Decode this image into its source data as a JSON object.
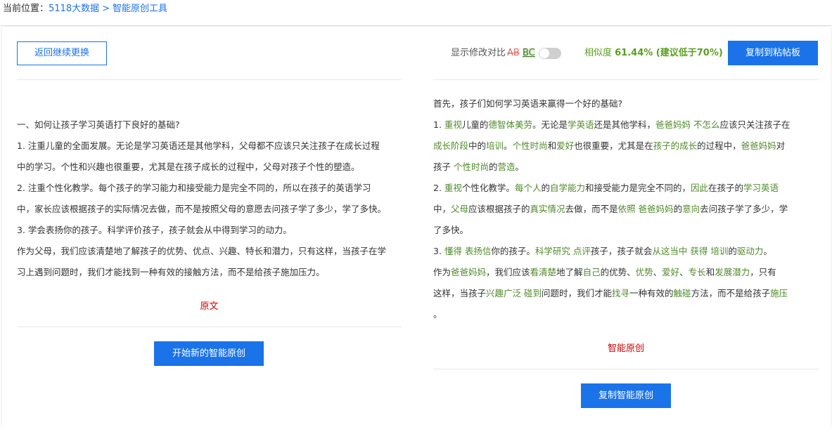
{
  "breadcrumb": {
    "prefix": "当前位置：",
    "home": "5118大数据",
    "sep": ">",
    "current": "智能原创工具"
  },
  "toolbar": {
    "back_label": "返回继续更换",
    "diff_label": "显示修改对比",
    "diff_ab": "AB",
    "diff_bc": "BC",
    "diff_toggle_on": false,
    "similarity_prefix": "相似度 ",
    "similarity_value": "61.44% (建议低于70%)",
    "copy_clipboard_label": "复制到粘帖板"
  },
  "original": {
    "lines": [
      " 一、如何让孩子学习英语打下良好的基础?",
      "1. 注重儿童的全面发展。无论是学习英语还是其他学科，父母都不应该只关注孩子在成长过程",
      "中的学习。个性和兴趣也很重要，尤其是在孩子成长的过程中，父母对孩子个性的塑造。",
      "2. 注重个性化教学。每个孩子的学习能力和接受能力是完全不同的，所以在孩子的英语学习",
      "中，家长应该根据孩子的实际情况去做，而不是按照父母的意愿去问孩子学了多少，学了多快。",
      "3. 学会表扬你的孩子。科学评价孩子，孩子就会从中得到学习的动力。",
      "作为父母，我们应该清楚地了解孩子的优势、优点、兴趣、特长和潜力，只有这样，当孩子在学",
      "习上遇到问题时，我们才能找到一种有效的接触方法，而不是给孩子施加压力。"
    ],
    "label": "原文",
    "start_button": "开始新的智能原创"
  },
  "rewritten": {
    "lines": [
      [
        {
          "t": "首先，孩子们如何学习英语来赢得一个好的基础?",
          "h": false
        }
      ],
      [
        {
          "t": "1. ",
          "h": false
        },
        {
          "t": "重视",
          "h": true
        },
        {
          "t": "儿童的",
          "h": false
        },
        {
          "t": "德智体美劳",
          "h": true
        },
        {
          "t": "。无论是",
          "h": false
        },
        {
          "t": "学英语",
          "h": true
        },
        {
          "t": "还是其他学科，",
          "h": false
        },
        {
          "t": "爸爸妈妈 不怎么",
          "h": true
        },
        {
          "t": "应该只关注孩子在",
          "h": false
        }
      ],
      [
        {
          "t": "成长阶段",
          "h": true
        },
        {
          "t": "中的",
          "h": false
        },
        {
          "t": "培训",
          "h": true
        },
        {
          "t": "。",
          "h": false
        },
        {
          "t": "个性时尚",
          "h": true
        },
        {
          "t": "和",
          "h": false
        },
        {
          "t": "爱好",
          "h": true
        },
        {
          "t": "也很重要，尤其是在",
          "h": false
        },
        {
          "t": "孩子的成长",
          "h": true
        },
        {
          "t": "的过程中，",
          "h": false
        },
        {
          "t": "爸爸妈妈",
          "h": true
        },
        {
          "t": "对",
          "h": false
        }
      ],
      [
        {
          "t": "孩子 ",
          "h": false
        },
        {
          "t": "个性时尚",
          "h": true
        },
        {
          "t": "的",
          "h": false
        },
        {
          "t": "营造",
          "h": true
        },
        {
          "t": "。",
          "h": false
        }
      ],
      [
        {
          "t": "2. ",
          "h": false
        },
        {
          "t": "重视",
          "h": true
        },
        {
          "t": "个性化教学。",
          "h": false
        },
        {
          "t": "每个人",
          "h": true
        },
        {
          "t": "的",
          "h": false
        },
        {
          "t": "自学能力",
          "h": true
        },
        {
          "t": "和接受能力是完全不同的，",
          "h": false
        },
        {
          "t": "因此",
          "h": true
        },
        {
          "t": "在孩子的",
          "h": false
        },
        {
          "t": "学习英语",
          "h": true
        }
      ],
      [
        {
          "t": "中，",
          "h": false
        },
        {
          "t": "父母",
          "h": true
        },
        {
          "t": "应该根据孩子的",
          "h": false
        },
        {
          "t": "真实情况",
          "h": true
        },
        {
          "t": "去做，而不是",
          "h": false
        },
        {
          "t": "依照 爸爸妈妈",
          "h": true
        },
        {
          "t": "的",
          "h": false
        },
        {
          "t": "意向",
          "h": true
        },
        {
          "t": "去问孩子学了多少，学",
          "h": false
        }
      ],
      [
        {
          "t": "了多快。",
          "h": false
        }
      ],
      [
        {
          "t": "3. ",
          "h": false
        },
        {
          "t": "懂得 表扬信",
          "h": true
        },
        {
          "t": "你的孩子。",
          "h": false
        },
        {
          "t": "科学研究 点评",
          "h": true
        },
        {
          "t": "孩子，孩子就会",
          "h": false
        },
        {
          "t": "从这当中 获得 培训",
          "h": true
        },
        {
          "t": "的",
          "h": false
        },
        {
          "t": "驱动力",
          "h": true
        },
        {
          "t": "。",
          "h": false
        }
      ],
      [
        {
          "t": "作为",
          "h": false
        },
        {
          "t": "爸爸妈妈",
          "h": true
        },
        {
          "t": "，我们应该",
          "h": false
        },
        {
          "t": "看清楚",
          "h": true
        },
        {
          "t": "地了解",
          "h": false
        },
        {
          "t": "自己",
          "h": true
        },
        {
          "t": "的优势、",
          "h": false
        },
        {
          "t": "优势",
          "h": true
        },
        {
          "t": "、",
          "h": false
        },
        {
          "t": "爱好",
          "h": true
        },
        {
          "t": "、",
          "h": false
        },
        {
          "t": "专长",
          "h": true
        },
        {
          "t": "和",
          "h": false
        },
        {
          "t": "发展潜力",
          "h": true
        },
        {
          "t": "，只有",
          "h": false
        }
      ],
      [
        {
          "t": "这样，当孩子",
          "h": false
        },
        {
          "t": "兴趣广泛 碰到",
          "h": true
        },
        {
          "t": "问题时，我们才能",
          "h": false
        },
        {
          "t": "找寻",
          "h": true
        },
        {
          "t": "一种有效的",
          "h": false
        },
        {
          "t": "触碰",
          "h": true
        },
        {
          "t": "方法，而不是给孩子",
          "h": false
        },
        {
          "t": "施压",
          "h": true
        }
      ],
      [
        {
          "t": "。",
          "h": false
        }
      ]
    ],
    "label": "智能原创",
    "copy_button": "复制智能原创"
  },
  "colors": {
    "accent": "#1a73e8",
    "highlight_green": "#4f8a2a",
    "similarity_green": "#5a9e1f",
    "label_red": "#cc0000"
  }
}
